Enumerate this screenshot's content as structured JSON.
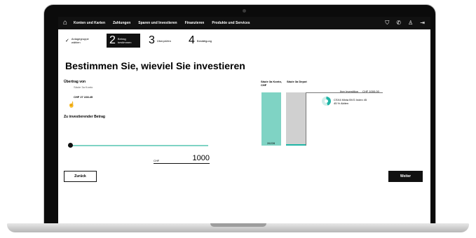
{
  "nav": {
    "items": [
      "Konten und Karten",
      "Zahlungen",
      "Sparen und Investieren",
      "Finanzieren",
      "Produkte und Services"
    ]
  },
  "steps": [
    {
      "num": "",
      "label": "Anlagegruppe wählen"
    },
    {
      "num": "2",
      "label": "Betrag bestimmen"
    },
    {
      "num": "3",
      "label": "Überprüfen"
    },
    {
      "num": "4",
      "label": "Bestätigung"
    }
  ],
  "page": {
    "title": "Bestimmen Sie, wieviel Sie investieren"
  },
  "transfer": {
    "label": "Übertrag von",
    "account_name": "Säule 3a Konto",
    "account_amount": "CHF 27 228.45"
  },
  "invest": {
    "label": "Zu investierender Betrag",
    "currency": "CHF",
    "value": "1000",
    "slider_fraction": 0.03
  },
  "chart": {
    "col1": "Säule 3a Konto, CHF",
    "col2": "Säule 3a Depot",
    "bar1_value": "26228",
    "top_label": "Ihre Investition",
    "top_value": "CHF 1000.00",
    "legend_line1": "CSX4 Mixta BVG Index 45",
    "legend_line2": "45 % Aktien",
    "colors": {
      "teal": "#7fd3c4",
      "gray": "#d0d0d0",
      "accent": "#1fb5a6"
    }
  },
  "buttons": {
    "back": "Zurück",
    "next": "Weiter"
  }
}
